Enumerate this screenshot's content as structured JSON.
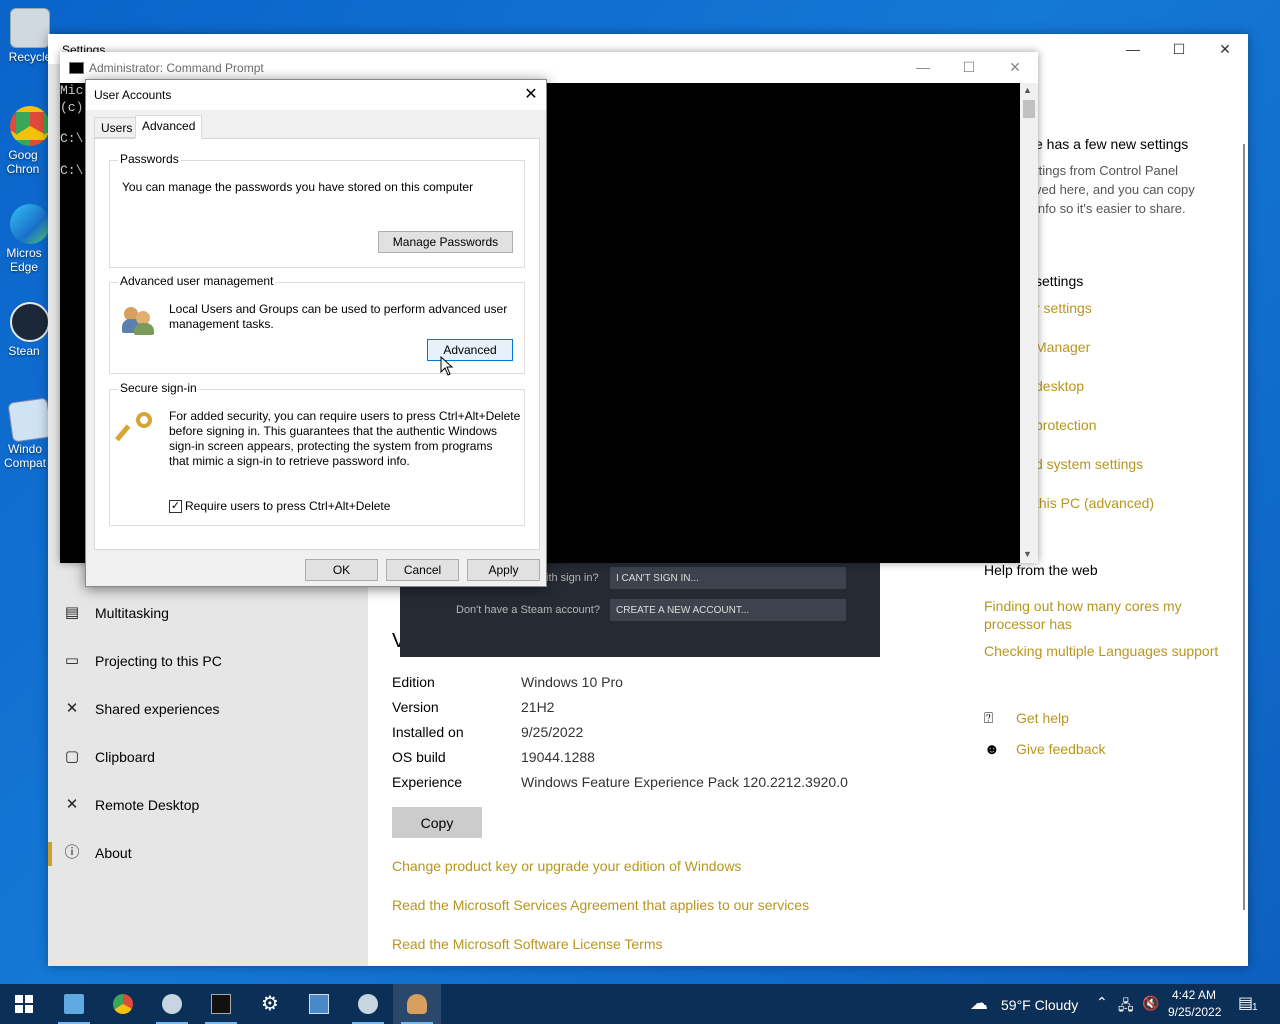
{
  "desktop": {
    "icons": [
      {
        "label": "Recycle",
        "icon": "recycle-bin-icon",
        "color": "#d0d8e0"
      },
      {
        "label": "Goog Chron",
        "icon": "chrome-icon",
        "color": "#e04a3a"
      },
      {
        "label": "Micros Edge",
        "icon": "edge-icon",
        "color": "#1fa0d8"
      },
      {
        "label": "Stean",
        "icon": "steam-icon",
        "color": "#1b2838"
      },
      {
        "label": "Windo Compat",
        "icon": "compat-icon",
        "color": "#cfe3f5"
      }
    ]
  },
  "settings": {
    "title": "Settings",
    "nav": [
      {
        "label": "Multitasking",
        "icon": "multitasking-icon",
        "glyph": "▤"
      },
      {
        "label": "Projecting to this PC",
        "icon": "projecting-icon",
        "glyph": "▭"
      },
      {
        "label": "Shared experiences",
        "icon": "shared-experiences-icon",
        "glyph": "✕"
      },
      {
        "label": "Clipboard",
        "icon": "clipboard-icon",
        "glyph": "▢"
      },
      {
        "label": "Remote Desktop",
        "icon": "remote-desktop-icon",
        "glyph": "✕"
      },
      {
        "label": "About",
        "icon": "info-icon",
        "glyph": "ⓘ"
      }
    ],
    "heading_fragment": "V",
    "specs": [
      {
        "label": "Edition",
        "value": "Windows 10 Pro"
      },
      {
        "label": "Version",
        "value": "21H2"
      },
      {
        "label": "Installed on",
        "value": "9/25/2022"
      },
      {
        "label": "OS build",
        "value": "19044.1288"
      },
      {
        "label": "Experience",
        "value": "Windows Feature Experience Pack 120.2212.3920.0"
      }
    ],
    "copy_label": "Copy",
    "links": [
      "Change product key or upgrade your edition of Windows",
      "Read the Microsoft Services Agreement that applies to our services",
      "Read the Microsoft Software License Terms"
    ],
    "right": {
      "new_settings_title": "e has a few new settings",
      "new_settings_body": [
        "ttings from Control Panel",
        "ved here, and you can copy",
        "info so it's easier to share."
      ],
      "related_title": "settings",
      "related_links": [
        "r settings",
        "Manager",
        "desktop",
        "protection",
        "d system settings",
        "this PC (advanced)"
      ],
      "help_title": "Help from the web",
      "help_links": [
        "Finding out how many cores my",
        "processor has",
        "Checking multiple Languages support"
      ],
      "get_help": "Get help",
      "give_feedback": "Give feedback"
    }
  },
  "steam": {
    "signin_label": "ith sign in?",
    "signin_button": "I CAN'T SIGN IN...",
    "account_label": "Don't have a Steam account?",
    "account_button": "CREATE A NEW ACCOUNT..."
  },
  "cmd": {
    "title": "Administrator: Command Prompt",
    "lines": [
      "Mic",
      "(c)",
      "C:\\",
      "C:\\"
    ]
  },
  "user_accounts": {
    "title": "User Accounts",
    "tabs": [
      "Users",
      "Advanced"
    ],
    "passwords": {
      "heading": "Passwords",
      "text": "You can manage the passwords you have stored on this computer",
      "button": "Manage Passwords"
    },
    "advanced_mgmt": {
      "heading": "Advanced user management",
      "text_line1": "Local Users and Groups can be used to perform advanced user",
      "text_line2": "management tasks.",
      "button": "Advanced"
    },
    "secure_signin": {
      "heading": "Secure sign-in",
      "text_lines": [
        "For added security, you can require users to press Ctrl+Alt+Delete",
        "before signing in. This guarantees that the authentic Windows",
        "sign-in screen appears, protecting the system from programs",
        "that mimic a sign-in to retrieve password info."
      ],
      "checkbox_label": "Require users to press Ctrl+Alt+Delete",
      "checked": true
    },
    "ok": "OK",
    "cancel": "Cancel",
    "apply": "Apply"
  },
  "taskbar": {
    "weather": "59°F  Cloudy",
    "time": "4:42 AM",
    "date": "9/25/2022",
    "notification_count": "1"
  }
}
